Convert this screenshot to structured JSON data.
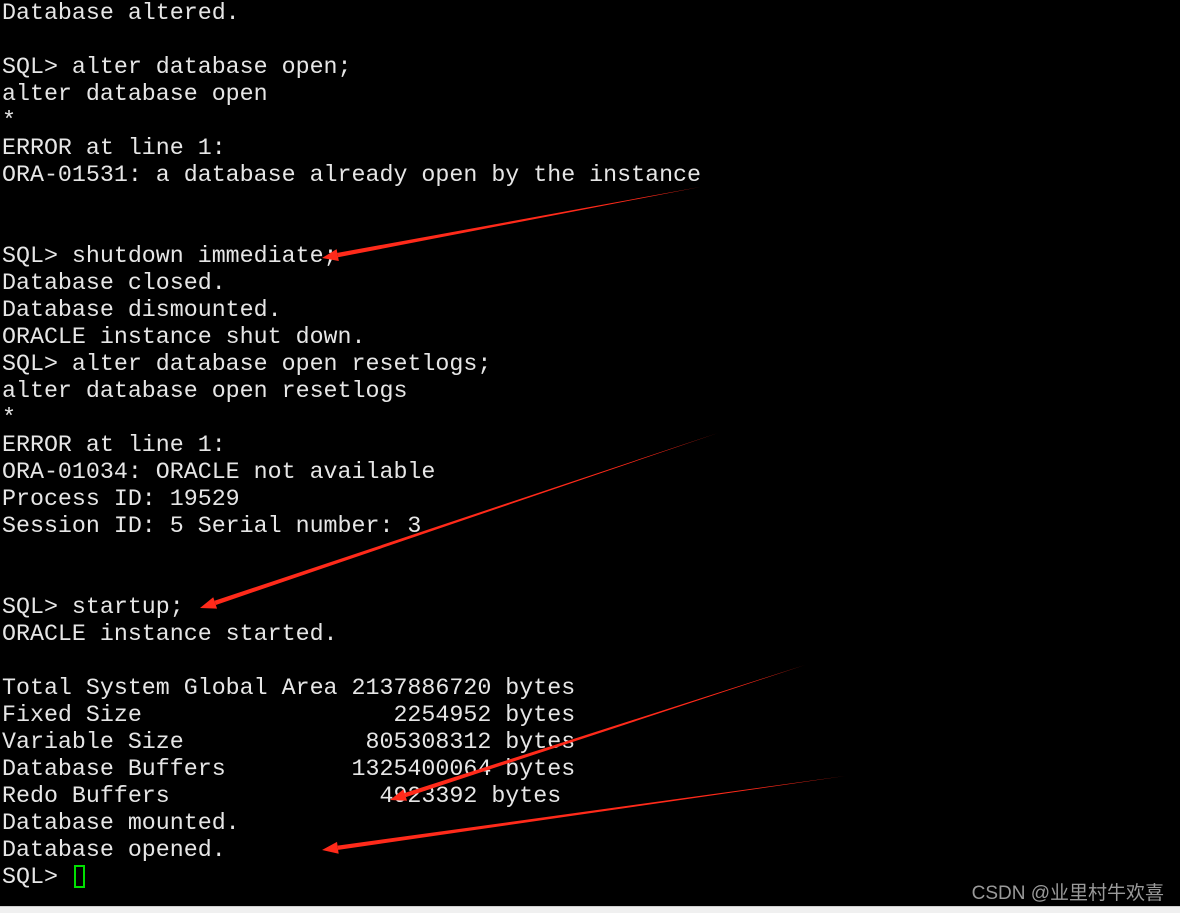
{
  "terminal": {
    "lines": [
      "Database altered.",
      "",
      "SQL> alter database open;",
      "alter database open",
      "*",
      "ERROR at line 1:",
      "ORA-01531: a database already open by the instance",
      "",
      "",
      "SQL> shutdown immediate;",
      "Database closed.",
      "Database dismounted.",
      "ORACLE instance shut down.",
      "SQL> alter database open resetlogs;",
      "alter database open resetlogs",
      "*",
      "ERROR at line 1:",
      "ORA-01034: ORACLE not available",
      "Process ID: 19529",
      "Session ID: 5 Serial number: 3",
      "",
      "",
      "SQL> startup;",
      "ORACLE instance started.",
      "",
      "Total System Global Area 2137886720 bytes",
      "Fixed Size                  2254952 bytes",
      "Variable Size             805308312 bytes",
      "Database Buffers         1325400064 bytes",
      "Redo Buffers               4923392 bytes",
      "Database mounted.",
      "Database opened."
    ],
    "prompt": "SQL> "
  },
  "watermark": "CSDN @业里村牛欢喜",
  "colors": {
    "background": "#000000",
    "text": "#e6e6e6",
    "cursor": "#00e000",
    "annotation_arrow": "#ff2a1a"
  }
}
